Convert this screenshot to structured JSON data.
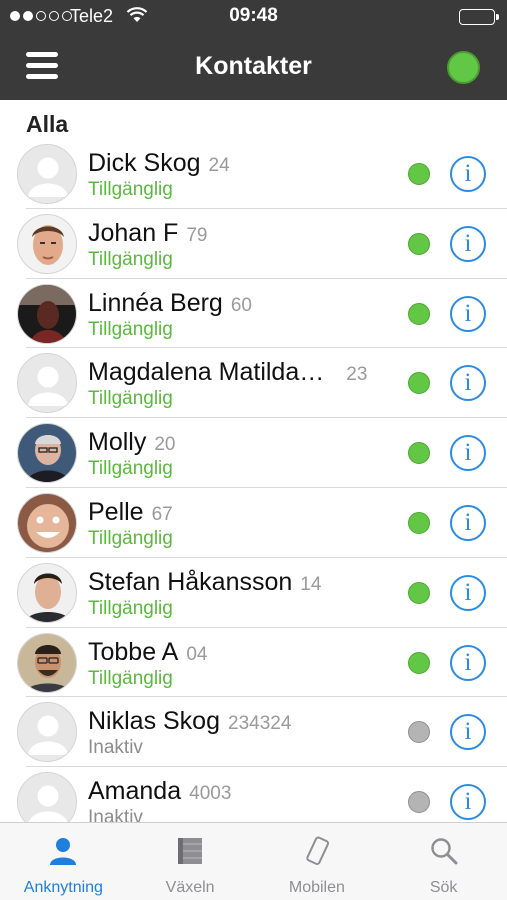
{
  "status_bar": {
    "carrier": "Tele2",
    "time": "09:48",
    "signal_bars": 2,
    "battery_level": 1.0
  },
  "nav": {
    "title": "Kontakter",
    "menu_icon": "hamburger-menu-icon",
    "presence_color": "#62c744"
  },
  "section": {
    "title": "Alla"
  },
  "contacts": [
    {
      "name": "Dick Skog",
      "ext": "24",
      "status": "Tillgänglig",
      "online": true,
      "avatar": "placeholder"
    },
    {
      "name": "Johan F",
      "ext": "79",
      "status": "Tillgänglig",
      "online": true,
      "avatar": "photo"
    },
    {
      "name": "Linnéa Berg",
      "ext": "60",
      "status": "Tillgänglig",
      "online": true,
      "avatar": "photo"
    },
    {
      "name": "Magdalena Matilda…",
      "ext": "23",
      "status": "Tillgänglig",
      "online": true,
      "avatar": "placeholder"
    },
    {
      "name": "Molly",
      "ext": "20",
      "status": "Tillgänglig",
      "online": true,
      "avatar": "photo"
    },
    {
      "name": "Pelle",
      "ext": "67",
      "status": "Tillgänglig",
      "online": true,
      "avatar": "photo"
    },
    {
      "name": "Stefan Håkansson",
      "ext": "14",
      "status": "Tillgänglig",
      "online": true,
      "avatar": "photo"
    },
    {
      "name": "Tobbe A",
      "ext": "04",
      "status": "Tillgänglig",
      "online": true,
      "avatar": "photo"
    },
    {
      "name": "Niklas Skog",
      "ext": "234324",
      "status": "Inaktiv",
      "online": false,
      "avatar": "placeholder"
    },
    {
      "name": "Amanda",
      "ext": "4003",
      "status": "Inaktiv",
      "online": false,
      "avatar": "placeholder"
    }
  ],
  "tabs": [
    {
      "label": "Anknytning",
      "icon": "person-icon",
      "active": true
    },
    {
      "label": "Växeln",
      "icon": "switchboard-icon",
      "active": false
    },
    {
      "label": "Mobilen",
      "icon": "mobile-phone-icon",
      "active": false
    },
    {
      "label": "Sök",
      "icon": "search-icon",
      "active": false
    }
  ],
  "colors": {
    "header_bg": "#3a3a3a",
    "available_green": "#5bb83d",
    "inactive_gray": "#8c8c8c",
    "accent_blue": "#1e7fde"
  }
}
